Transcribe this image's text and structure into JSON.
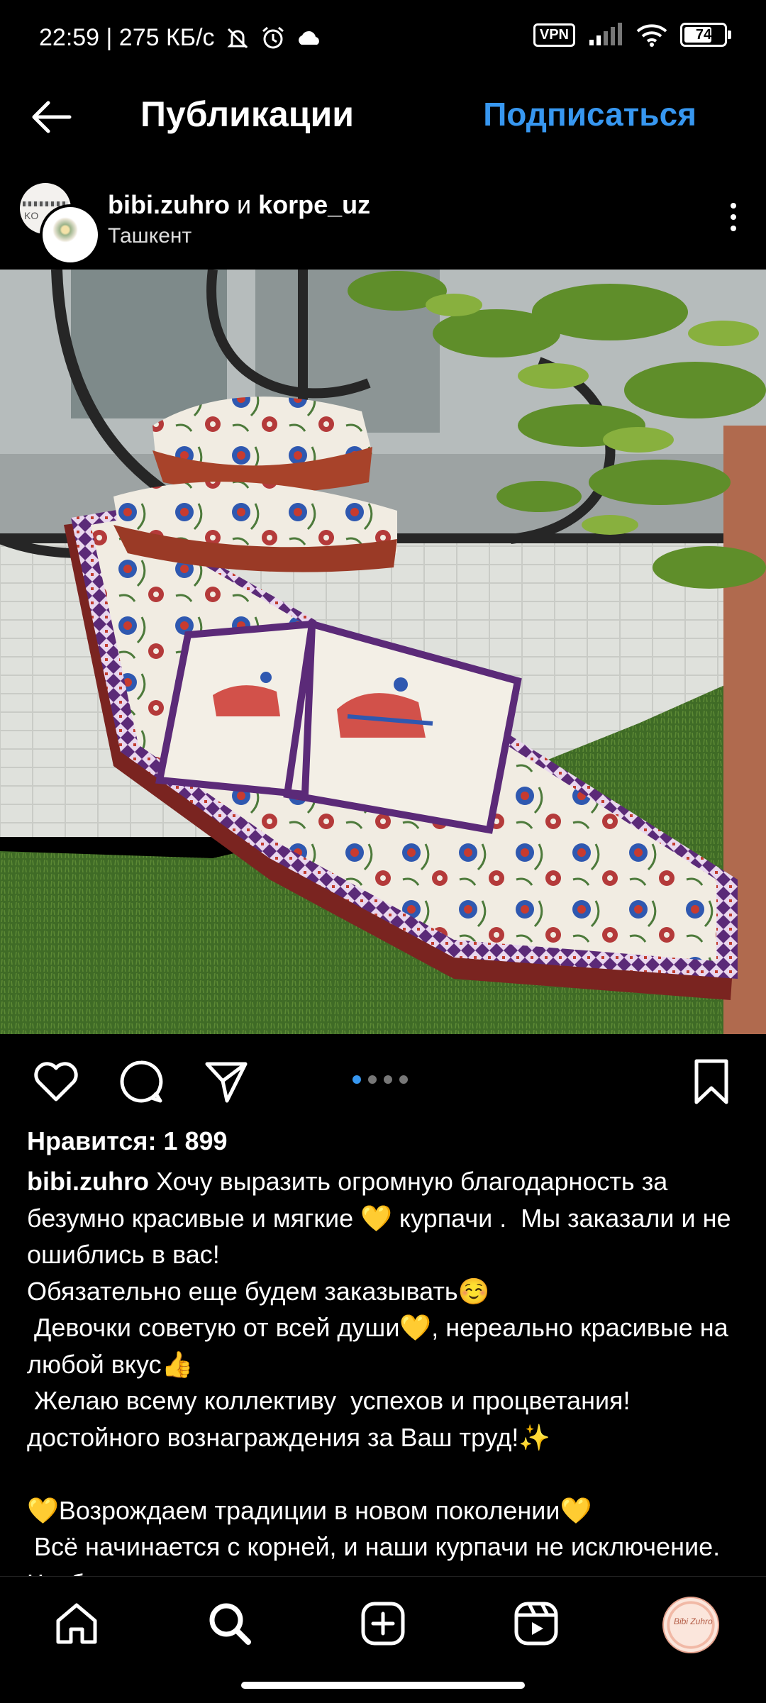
{
  "status_bar": {
    "time_speed": "22:59 | 275 КБ/с",
    "vpn": "VPN",
    "battery": "74",
    "battery_level": 0.74
  },
  "top_nav": {
    "title": "Публикации",
    "follow_label": "Подписаться",
    "back_icon": "arrow-left-icon"
  },
  "post_header": {
    "user1": "bibi.zuhro",
    "conjunction": "и",
    "user2": "korpe_uz",
    "location": "Ташкент",
    "avatar1_text": "KO"
  },
  "actions": {
    "icons": [
      "heart-icon",
      "comment-icon",
      "share-icon",
      "bookmark-icon"
    ],
    "carousel_count": 4,
    "carousel_active": 1
  },
  "likes": "Нравится: 1 899",
  "caption": {
    "username": "bibi.zuhro",
    "text": " Хочу выразить огромную благодарность за безумно красивые и мягкие 💛 курпачи .  Мы заказали и не ошиблись в вас!\nОбязательно еще будем заказывать☺️\n Девочки советую от всей души💛, нереально красивые на любой вкус👍\n Желаю всему коллективу  успехов и процветания! достойного вознаграждения за Ваш труд!✨\n\n💛Возрождаем традиции в новом поколении💛\n Всё начинается с корней, и наши курпачи не исключение. Чтобы почувствовать, чем я"
  },
  "bottom_nav": {
    "items": [
      "home-icon",
      "search-icon",
      "create-icon",
      "reels-icon",
      "profile-avatar"
    ],
    "profile_text": "Bibi Zuhro"
  },
  "colors": {
    "accent": "#3797f0",
    "background": "#000000"
  }
}
